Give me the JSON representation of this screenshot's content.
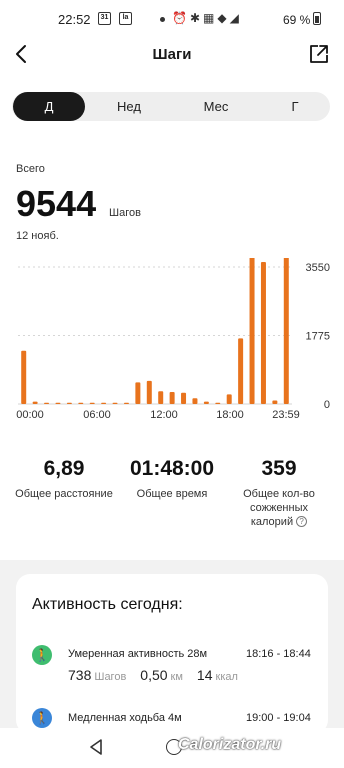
{
  "status": {
    "time": "22:52",
    "calendar_badge": "31",
    "battery_percent": "69 %"
  },
  "header": {
    "title": "Шаги"
  },
  "tabs": [
    {
      "label": "Д",
      "active": true
    },
    {
      "label": "Нед",
      "active": false
    },
    {
      "label": "Мес",
      "active": false
    },
    {
      "label": "Г",
      "active": false
    }
  ],
  "summary": {
    "label": "Всего",
    "value": "9544",
    "unit": "Шагов",
    "date": "12 нояб."
  },
  "chart_data": {
    "type": "bar",
    "title": "",
    "xlabel": "",
    "ylabel": "",
    "ylim": [
      0,
      3550
    ],
    "y_ticks": [
      "3550",
      "1775",
      "0"
    ],
    "x_ticks": [
      "00:00",
      "06:00",
      "12:00",
      "18:00",
      "23:59"
    ],
    "hours": [
      0,
      1,
      2,
      3,
      4,
      5,
      6,
      7,
      8,
      9,
      10,
      11,
      12,
      13,
      14,
      15,
      16,
      17,
      18,
      19,
      20,
      21,
      22,
      23
    ],
    "values": [
      1380,
      60,
      0,
      0,
      0,
      0,
      30,
      0,
      0,
      0,
      560,
      600,
      330,
      310,
      290,
      150,
      60,
      30,
      250,
      1700,
      3900,
      3680,
      90,
      5620
    ],
    "color": "#e8731d",
    "grid": "dashed"
  },
  "stats": [
    {
      "value": "6,89",
      "label": "Общее расстояние"
    },
    {
      "value": "01:48:00",
      "label": "Общее время"
    },
    {
      "value": "359",
      "label": "Общее кол-во сожженных калорий"
    }
  ],
  "activity": {
    "title": "Активность сегодня",
    "items": [
      {
        "name": "Умеренная активность 28м",
        "time": "18:16 - 18:44",
        "icon": "walking-person-icon",
        "color": "#3fbd6f",
        "steps": "738",
        "steps_unit": "Шагов",
        "distance": "0,50",
        "distance_unit": "км",
        "kcal": "14",
        "kcal_unit": "ккал"
      },
      {
        "name": "Медленная ходьба 4м",
        "time": "19:00 - 19:04",
        "icon": "slow-walk-icon",
        "color": "#3a86d8"
      }
    ]
  },
  "watermark": "Calorizator.ru"
}
